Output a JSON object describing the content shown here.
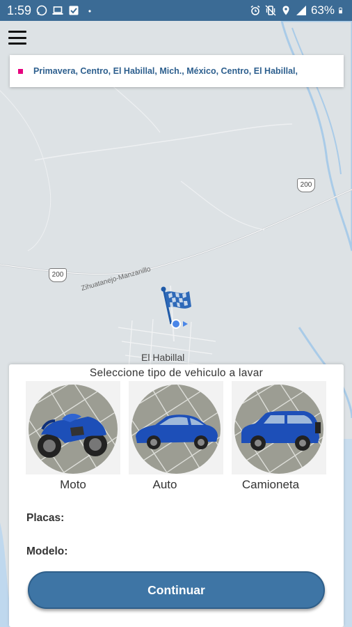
{
  "status_bar": {
    "time": "1:59",
    "battery": "63%",
    "left_icons": [
      "whatsapp-icon",
      "laptop-icon",
      "checkbox-icon",
      "dot-icon"
    ],
    "right_icons": [
      "alarm-icon",
      "vibrate-icon",
      "location-icon",
      "signal-icon"
    ]
  },
  "header": {
    "menu_icon": "hamburger-menu-icon",
    "address": "Primavera, Centro, El Habillal, Mich., México, Centro, El Habillal,"
  },
  "map": {
    "town_label": "El Habillal",
    "road_label": "Zihuatanejo-Manzanillo",
    "highway_shields": [
      "200",
      "200"
    ],
    "marker": "checkered-flag-icon"
  },
  "panel": {
    "title": "Seleccione tipo de vehiculo a lavar",
    "vehicles": [
      {
        "label": "Moto",
        "icon": "motorcycle-icon"
      },
      {
        "label": "Auto",
        "icon": "car-icon"
      },
      {
        "label": "Camioneta",
        "icon": "suv-icon"
      }
    ],
    "fields": {
      "plates_label": "Placas:",
      "plates_value": "",
      "model_label": "Modelo:",
      "model_value": ""
    },
    "continue_label": "Continuar"
  },
  "colors": {
    "status_bar": "#3b6b95",
    "accent": "#3e75a5",
    "address_text": "#2d5f8e",
    "address_dot": "#e6007e",
    "vehicle_blue": "#1d4fb8"
  }
}
